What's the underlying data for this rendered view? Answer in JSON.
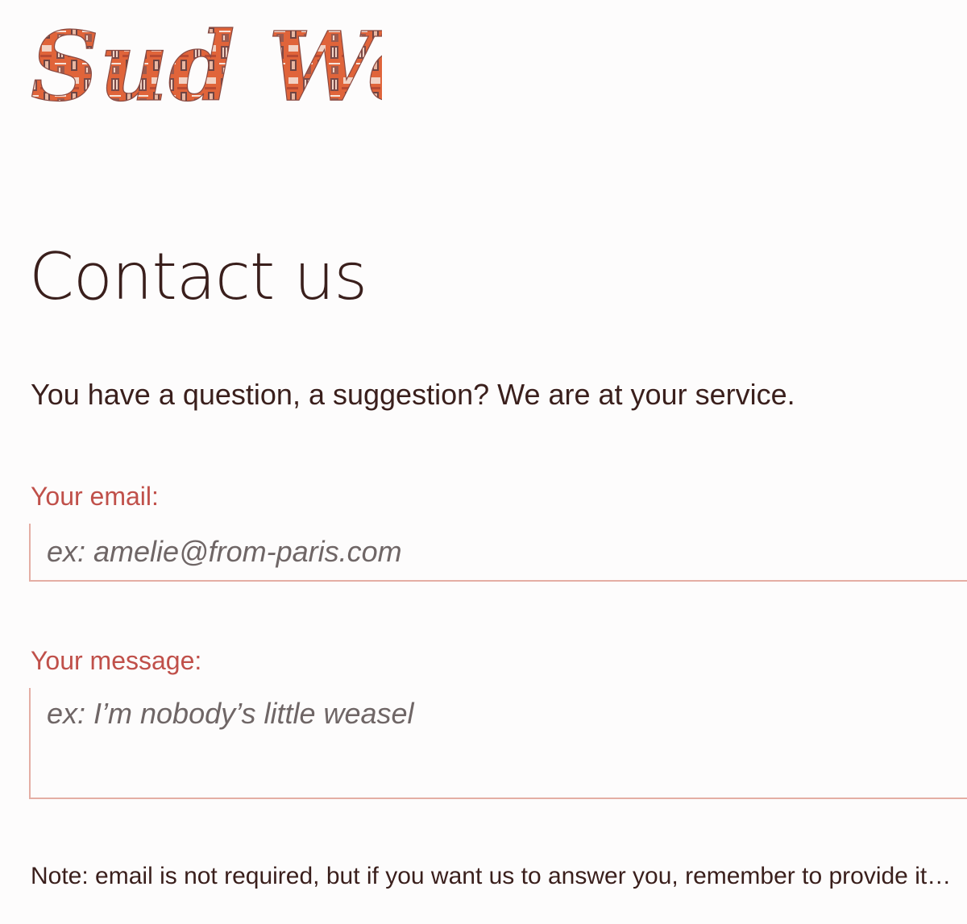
{
  "logo": {
    "text": "Sud Web",
    "colors": {
      "primary": "#e0643a",
      "dark": "#7a4a48",
      "light": "#f2d2c4"
    }
  },
  "page_title": "Contact us",
  "intro": "You have a question, a suggestion? We are at your service.",
  "form": {
    "email": {
      "label": "Your email:",
      "placeholder": "ex: amelie@from-paris.com",
      "value": ""
    },
    "message": {
      "label": "Your message:",
      "placeholder": "ex: I’m nobody’s little weasel",
      "value": ""
    }
  },
  "note": "Note: email is not required, but if you want us to answer you, remember to provide it…",
  "colors": {
    "text": "#3a1f1c",
    "label": "#c0504a",
    "field_border": "#e4aea4",
    "placeholder": "#6f6666",
    "background": "#fdfcfc"
  }
}
